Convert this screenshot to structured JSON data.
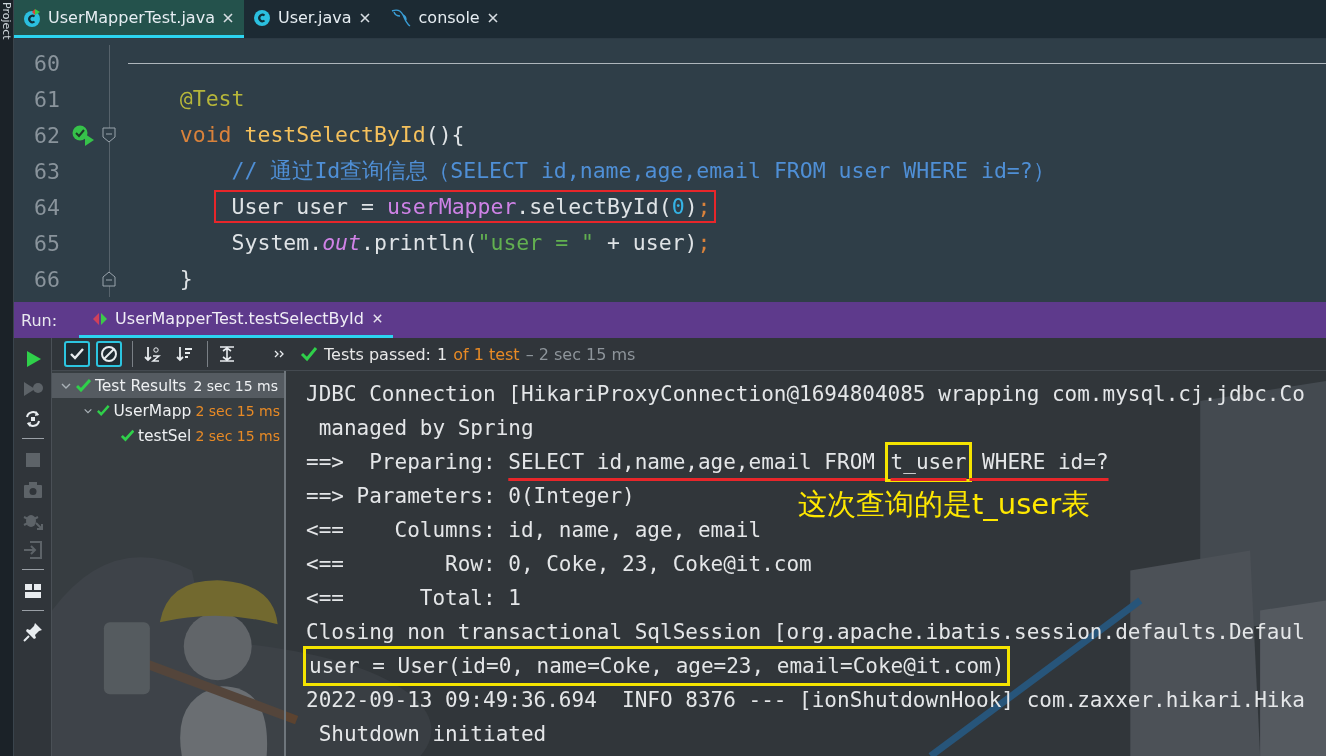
{
  "side_strip": {
    "label": "Project"
  },
  "editor_tabs": [
    {
      "label": "UserMapperTest.java",
      "kind": "test_class",
      "selected": true
    },
    {
      "label": "User.java",
      "kind": "class",
      "selected": false
    },
    {
      "label": "console",
      "kind": "database",
      "selected": false
    }
  ],
  "code_lines": [
    {
      "number": "60",
      "separator_after": true
    },
    {
      "number": "61",
      "tokens": [
        {
          "text": "    @Test",
          "kind": "annotation"
        }
      ]
    },
    {
      "number": "62",
      "gutter_icon": {
        "kind": "run_test"
      },
      "fold": {
        "kind": "start"
      },
      "tokens": [
        {
          "text": "    void ",
          "kind": "keyword"
        },
        {
          "text": "testSelectById",
          "kind": "method"
        },
        {
          "text": "(){",
          "kind": "plain"
        }
      ]
    },
    {
      "number": "63",
      "tokens": [
        {
          "text": "        // 通过Id查询信息（SELECT id,name,age,email FROM user WHERE id=?）",
          "kind": "comment"
        }
      ]
    },
    {
      "number": "64",
      "boxed": true,
      "tokens": [
        {
          "text": "        User user = ",
          "kind": "plain"
        },
        {
          "text": "userMapper",
          "kind": "field"
        },
        {
          "text": ".selectById(",
          "kind": "plain"
        },
        {
          "text": "0",
          "kind": "number"
        },
        {
          "text": ")",
          "kind": "plain"
        },
        {
          "text": ";",
          "kind": "semicolon"
        }
      ]
    },
    {
      "number": "65",
      "tokens": [
        {
          "text": "        System.",
          "kind": "plain"
        },
        {
          "text": "out",
          "kind": "static"
        },
        {
          "text": ".println(",
          "kind": "plain"
        },
        {
          "text": "\"user = \"",
          "kind": "string"
        },
        {
          "text": " + user)",
          "kind": "plain"
        },
        {
          "text": ";",
          "kind": "semicolon"
        }
      ]
    },
    {
      "number": "66",
      "fold": {
        "kind": "end"
      },
      "tokens": [
        {
          "text": "    }",
          "kind": "plain"
        }
      ]
    }
  ],
  "run_panel": {
    "label": "Run:",
    "tabs": [
      {
        "label": "UserMapperTest.testSelectById",
        "selected": true
      }
    ],
    "side_actions": [
      [
        {
          "kind": "run",
          "disabled": false
        },
        {
          "kind": "rerun_failed",
          "disabled": true
        },
        {
          "kind": "auto_test",
          "disabled": false
        }
      ],
      [
        {
          "kind": "stop",
          "disabled": true
        },
        {
          "kind": "snapshot",
          "disabled": true
        },
        {
          "kind": "bug_export",
          "disabled": true
        },
        {
          "kind": "import",
          "disabled": true
        }
      ],
      [
        {
          "kind": "layout",
          "disabled": false
        }
      ],
      [
        {
          "kind": "pin",
          "disabled": false
        }
      ]
    ],
    "toolbar": [
      [
        {
          "kind": "show_passed",
          "on": true
        },
        {
          "kind": "show_ignored",
          "on": true
        }
      ],
      [
        {
          "kind": "sort_alpha",
          "on": false
        },
        {
          "kind": "sort_duration",
          "on": false
        }
      ],
      [
        {
          "kind": "expand_collapse",
          "on": false
        }
      ],
      [
        {
          "kind": "more"
        }
      ]
    ],
    "status": {
      "label": "Tests passed:",
      "passed": "1",
      "total": "of 1 test",
      "time": "– 2 sec 15 ms"
    },
    "test_tree": [
      {
        "label": "Test Results",
        "time": "2 sec 15 ms",
        "selected": true,
        "expanded": true,
        "children": [
          {
            "label": "UserMapp",
            "time": "2 sec 15 ms",
            "selected": false,
            "expanded": true,
            "children": [
              {
                "label": "testSel",
                "time": "2 sec 15 ms",
                "selected": false
              }
            ]
          }
        ]
      }
    ],
    "console_lines": [
      {
        "segments": [
          {
            "text": "JDBC Connection [HikariProxyConnection@1694804085 wrapping com.mysql.cj.jdbc.Co"
          }
        ]
      },
      {
        "segments": [
          {
            "text": " managed by Spring"
          }
        ]
      },
      {
        "segments": [
          {
            "text": "==>  Preparing: "
          },
          {
            "text": "SELECT id,name,age,email FROM ",
            "underlined": true
          },
          {
            "text": "t_user",
            "underlined": true,
            "boxed": true
          },
          {
            "text": " WHERE id=?",
            "underlined": true
          }
        ]
      },
      {
        "segments": [
          {
            "text": "==> Parameters: 0(Integer)"
          }
        ]
      },
      {
        "segments": [
          {
            "text": "<==    Columns: id, name, age, email"
          }
        ]
      },
      {
        "segments": [
          {
            "text": "<==        Row: 0, Coke, 23, Coke@it.com"
          }
        ]
      },
      {
        "segments": [
          {
            "text": "<==      Total: 1"
          }
        ]
      },
      {
        "segments": [
          {
            "text": "Closing non transactional SqlSession [org.apache.ibatis.session.defaults.Defaul"
          }
        ]
      },
      {
        "segments": [
          {
            "text": "user = User(id=0, name=Coke, age=23, email=Coke@it.com)",
            "boxed": true
          }
        ]
      },
      {
        "segments": [
          {
            "text": "2022-09-13 09:49:36.694  INFO 8376 --- [ionShutdownHook] com.zaxxer.hikari.Hika"
          }
        ]
      },
      {
        "segments": [
          {
            "text": " Shutdown initiated"
          }
        ]
      }
    ],
    "console_note": "这次查询的是t_user表"
  }
}
